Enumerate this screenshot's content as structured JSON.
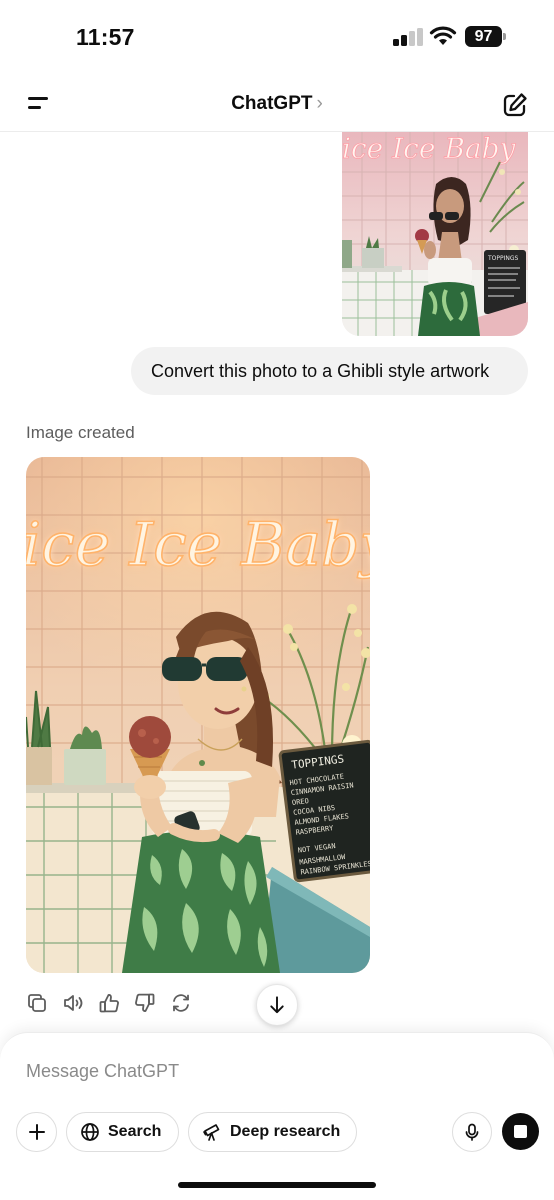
{
  "status_bar": {
    "time": "11:57",
    "battery": "97",
    "icons": [
      "cellular-signal-icon",
      "wifi-icon",
      "battery-icon"
    ]
  },
  "header": {
    "title": "ChatGPT",
    "chevron": "›",
    "icons": [
      "menu-icon",
      "new-chat-icon"
    ]
  },
  "conversation": {
    "user_message": "Convert this photo to a Ghibli style artwork",
    "image_created_label": "Image created",
    "generated_image": {
      "neon_sign": "ice Ice Baby",
      "menu_board": {
        "title": "TOPPINGS",
        "items": [
          "HOT CHOCOLATE",
          "CINNAMON RAISIN",
          "OREO",
          "COCOA NIBS",
          "ALMOND FLAKES",
          "RASPBERRY",
          "",
          "NOT VEGAN",
          "MARSHMALLOW",
          "RAINBOW SPRINKLES"
        ]
      }
    },
    "message_actions": [
      "copy-icon",
      "read-aloud-icon",
      "thumbs-up-icon",
      "thumbs-down-icon",
      "regenerate-icon"
    ]
  },
  "composer": {
    "placeholder": "Message ChatGPT",
    "buttons": {
      "plus": "+",
      "search": "Search",
      "deep_research": "Deep research"
    }
  },
  "colors": {
    "accent": "#0d0d0d",
    "bubble": "#f2f2f2",
    "muted_text": "#5d5d5d"
  }
}
